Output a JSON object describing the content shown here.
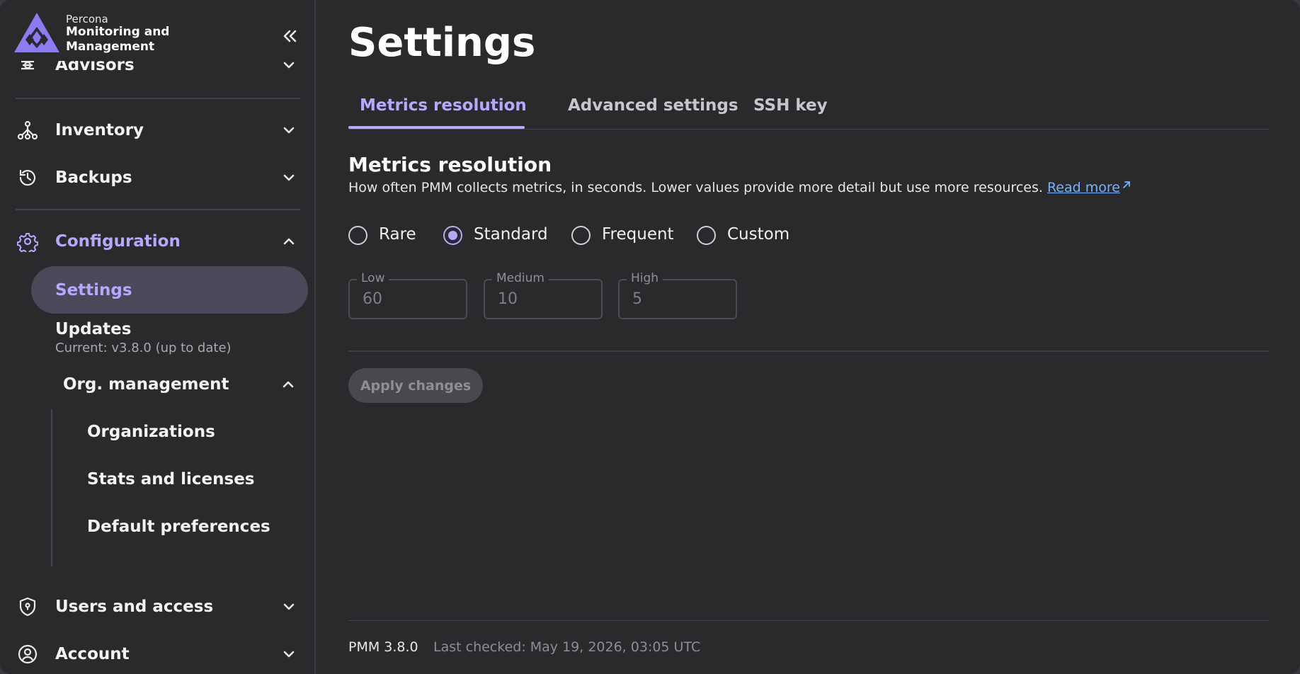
{
  "brand": {
    "company": "Percona",
    "product": "Monitoring and Management"
  },
  "sidebar": {
    "items": [
      {
        "label": "Advisors",
        "icon": "advisors-icon",
        "expanded": false
      },
      {
        "label": "Inventory",
        "icon": "inventory-icon",
        "expanded": false
      },
      {
        "label": "Backups",
        "icon": "backups-icon",
        "expanded": false
      },
      {
        "label": "Configuration",
        "icon": "gear-icon",
        "expanded": true,
        "active": true
      },
      {
        "label": "Users and access",
        "icon": "shield-icon",
        "expanded": false
      },
      {
        "label": "Account",
        "icon": "account-icon",
        "expanded": false
      }
    ],
    "configuration_children": {
      "settings": "Settings",
      "updates": "Updates",
      "updates_caption": "Current: v3.8.0 (up to date)",
      "org_management": "Org. management",
      "org_children": [
        "Organizations",
        "Stats and licenses",
        "Default preferences"
      ]
    }
  },
  "main": {
    "title": "Settings",
    "tabs": [
      {
        "label": "Metrics resolution",
        "active": true
      },
      {
        "label": "Advanced settings",
        "active": false
      },
      {
        "label": "SSH key",
        "active": false
      }
    ],
    "section": {
      "title": "Metrics resolution",
      "description": "How often PMM collects metrics, in seconds. Lower values provide more detail but use more resources.",
      "read_more": "Read more"
    },
    "resolution_options": [
      {
        "label": "Rare",
        "selected": false
      },
      {
        "label": "Standard",
        "selected": true
      },
      {
        "label": "Frequent",
        "selected": false
      },
      {
        "label": "Custom",
        "selected": false
      }
    ],
    "fields": [
      {
        "label": "Low",
        "value": "60"
      },
      {
        "label": "Medium",
        "value": "10"
      },
      {
        "label": "High",
        "value": "5"
      }
    ],
    "apply_label": "Apply changes"
  },
  "footer": {
    "version": "PMM 3.8.0",
    "last_checked": "Last checked: May 19, 2026, 03:05 UTC"
  },
  "colors": {
    "accent": "#b6a8ff",
    "background": "#2a292c",
    "link": "#74b3ff",
    "active_pill": "#4a4859"
  }
}
